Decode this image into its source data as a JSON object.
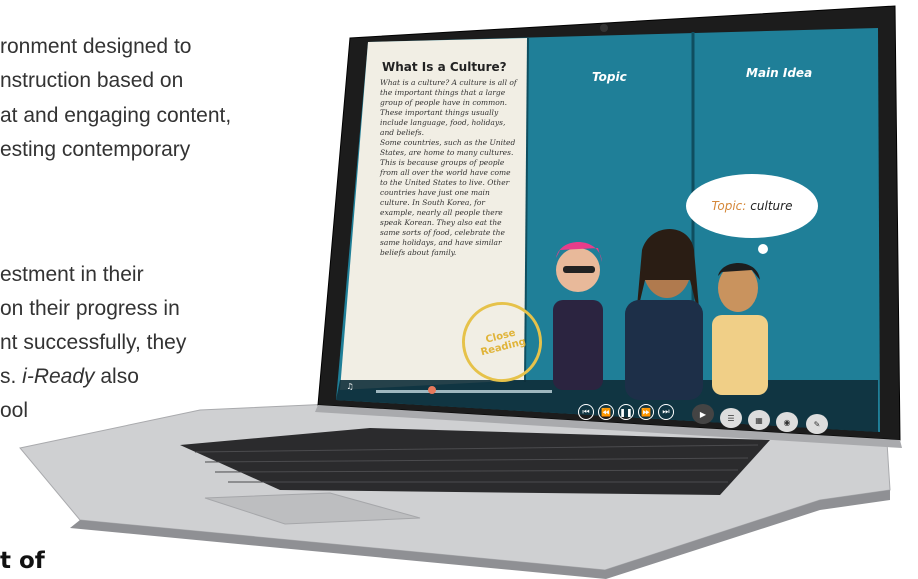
{
  "background_text": {
    "lines": [
      "ronment designed to",
      "nstruction based on",
      "at and engaging content,",
      "esting contemporary",
      "estment in their",
      " on their progress in",
      "nt successfully, they",
      "s. ",
      "ool"
    ],
    "italic_fragment": "i-Ready",
    "italic_tail": " also",
    "bold_fragment": "t of"
  },
  "screen": {
    "reading": {
      "title": "What Is a Culture?",
      "paragraph1": "What is a culture? A culture is all of the important things that a large group of people have in common. These important things usually include language, food, holidays, and beliefs.",
      "paragraph2": "Some countries, such as the United States, are home to many cultures. This is because groups of people from all over the world have come to the United States to live. Other countries have just one main culture. In South Korea, for example, nearly all people there speak Korean. They also eat the same sorts of food, celebrate the same holidays, and have similar beliefs about family.",
      "stamp_line1": "Close",
      "stamp_line2": "Reading"
    },
    "columns": {
      "topic_label": "Topic",
      "main_idea_label": "Main Idea"
    },
    "thought_bubble": {
      "key": "Topic:",
      "value": "culture"
    }
  },
  "colors": {
    "panel": "#1f7f98",
    "paper": "#f1eee4",
    "bezel": "#1c1c1c",
    "deck": "#cfd0d2"
  }
}
